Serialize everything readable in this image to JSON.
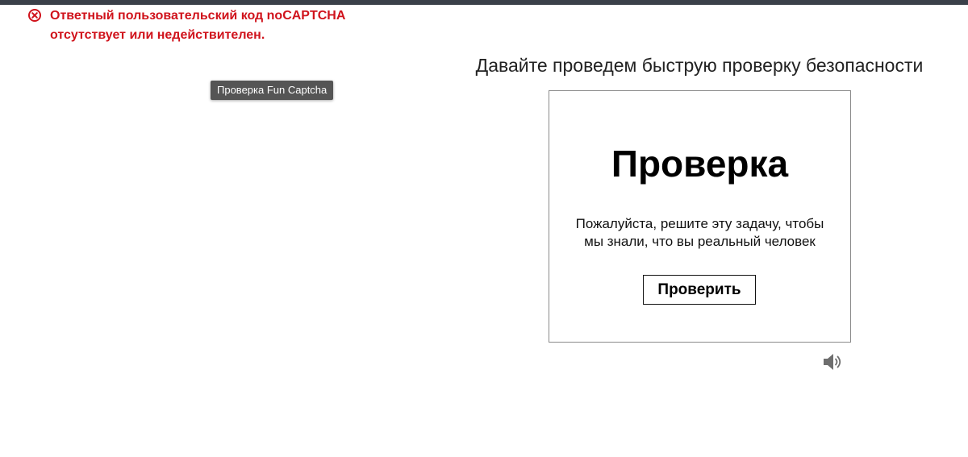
{
  "error": {
    "icon": "error-circle-x-icon",
    "line1": "Ответный пользовательский код noCAPTCHA",
    "line2": "отсутствует или недействителен.",
    "color": "#d0131c"
  },
  "tooltip": {
    "text": "Проверка Fun Captcha"
  },
  "security_check": {
    "heading": "Давайте проведем быструю проверку безопасности"
  },
  "captcha": {
    "title": "Проверка",
    "description_line1": "Пожалуйста, решите эту задачу, чтобы",
    "description_line2": "мы знали, что вы реальный человек",
    "button_label": "Проверить",
    "audio_icon": "speaker-audio-icon"
  },
  "colors": {
    "top_bar": "#3a4049",
    "tooltip_bg": "#555555",
    "box_border": "#8a8a8a"
  }
}
